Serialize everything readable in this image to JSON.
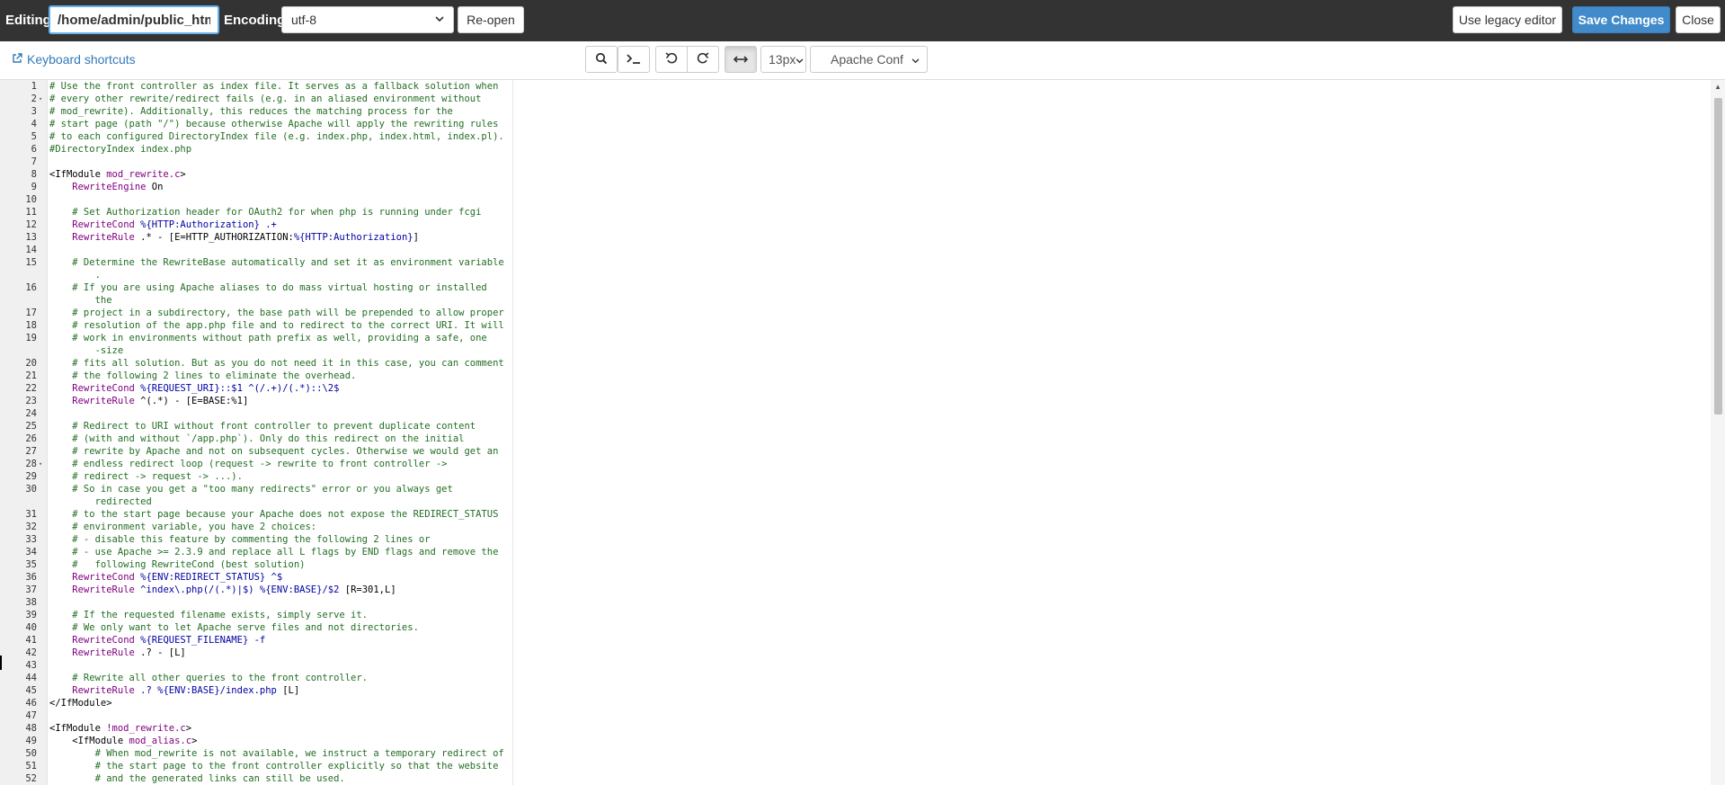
{
  "header": {
    "editing_label": "Editing:",
    "file_path": "/home/admin/public_htm",
    "encoding_label": "Encoding:",
    "encoding_value": "utf-8",
    "reopen_label": "Re-open",
    "legacy_label": "Use legacy editor",
    "save_label": "Save Changes",
    "close_label": "Close"
  },
  "toolbar": {
    "shortcuts_label": "Keyboard shortcuts",
    "font_size": "13px",
    "mode": "Apache Conf",
    "icons": [
      "search-icon",
      "terminal-icon",
      "undo-icon",
      "redo-icon",
      "wrap-icon"
    ]
  },
  "colors": {
    "topbar_bg": "#333333",
    "primary": "#428bca",
    "comment": "#236e24",
    "directive": "#800080",
    "variable": "#0000a2"
  },
  "editor": {
    "lines": [
      {
        "n": "1",
        "fold": "",
        "segs": [
          {
            "t": "# Use the front controller as index file. It serves as a fallback solution when",
            "c": "cmt"
          }
        ]
      },
      {
        "n": "2",
        "fold": "▾",
        "segs": [
          {
            "t": "# every other rewrite/redirect fails (e.g. in an aliased environment without",
            "c": "cmt"
          }
        ]
      },
      {
        "n": "3",
        "fold": "",
        "segs": [
          {
            "t": "# mod_rewrite). Additionally, this reduces the matching process for the",
            "c": "cmt"
          }
        ]
      },
      {
        "n": "4",
        "fold": "",
        "segs": [
          {
            "t": "# start page (path \"/\") because otherwise Apache will apply the rewriting rules",
            "c": "cmt"
          }
        ]
      },
      {
        "n": "5",
        "fold": "",
        "segs": [
          {
            "t": "# to each configured DirectoryIndex file (e.g. index.php, index.html, index.pl).",
            "c": "cmt"
          }
        ]
      },
      {
        "n": "6",
        "fold": "",
        "segs": [
          {
            "t": "#DirectoryIndex index.php",
            "c": "cmt"
          }
        ]
      },
      {
        "n": "7",
        "fold": "",
        "segs": []
      },
      {
        "n": "8",
        "fold": "",
        "segs": [
          {
            "t": "<IfModule ",
            "c": "tag"
          },
          {
            "t": "mod_rewrite.c",
            "c": "dir"
          },
          {
            "t": ">",
            "c": "tag"
          }
        ]
      },
      {
        "n": "9",
        "fold": "",
        "segs": [
          {
            "t": "    ",
            "c": ""
          },
          {
            "t": "RewriteEngine",
            "c": "dir"
          },
          {
            "t": " On",
            "c": ""
          }
        ]
      },
      {
        "n": "10",
        "fold": "",
        "segs": []
      },
      {
        "n": "11",
        "fold": "",
        "segs": [
          {
            "t": "    # Set Authorization header for OAuth2 for when php is running under fcgi",
            "c": "cmt"
          }
        ]
      },
      {
        "n": "12",
        "fold": "",
        "segs": [
          {
            "t": "    ",
            "c": ""
          },
          {
            "t": "RewriteCond",
            "c": "dir"
          },
          {
            "t": " %{HTTP:Authorization} .+",
            "c": "var"
          }
        ]
      },
      {
        "n": "13",
        "fold": "",
        "segs": [
          {
            "t": "    ",
            "c": ""
          },
          {
            "t": "RewriteRule",
            "c": "dir"
          },
          {
            "t": " .* - [E=HTTP_AUTHORIZATION:",
            "c": ""
          },
          {
            "t": "%{HTTP:Authorization}",
            "c": "var"
          },
          {
            "t": "]",
            "c": ""
          }
        ]
      },
      {
        "n": "14",
        "fold": "",
        "segs": []
      },
      {
        "n": "15",
        "fold": "",
        "segs": [
          {
            "t": "    # Determine the RewriteBase automatically and set it as environment variable",
            "c": "cmt"
          }
        ]
      },
      {
        "n": "",
        "fold": "",
        "segs": [
          {
            "t": "        .",
            "c": "cmt"
          }
        ]
      },
      {
        "n": "16",
        "fold": "",
        "segs": [
          {
            "t": "    # If you are using Apache aliases to do mass virtual hosting or installed",
            "c": "cmt"
          }
        ]
      },
      {
        "n": "",
        "fold": "",
        "segs": [
          {
            "t": "        the",
            "c": "cmt"
          }
        ]
      },
      {
        "n": "17",
        "fold": "",
        "segs": [
          {
            "t": "    # project in a subdirectory, the base path will be prepended to allow proper",
            "c": "cmt"
          }
        ]
      },
      {
        "n": "18",
        "fold": "",
        "segs": [
          {
            "t": "    # resolution of the app.php file and to redirect to the correct URI. It will",
            "c": "cmt"
          }
        ]
      },
      {
        "n": "19",
        "fold": "",
        "segs": [
          {
            "t": "    # work in environments without path prefix as well, providing a safe, one",
            "c": "cmt"
          }
        ]
      },
      {
        "n": "",
        "fold": "",
        "segs": [
          {
            "t": "        -size",
            "c": "cmt"
          }
        ]
      },
      {
        "n": "20",
        "fold": "",
        "segs": [
          {
            "t": "    # fits all solution. But as you do not need it in this case, you can comment",
            "c": "cmt"
          }
        ]
      },
      {
        "n": "21",
        "fold": "",
        "segs": [
          {
            "t": "    # the following 2 lines to eliminate the overhead.",
            "c": "cmt"
          }
        ]
      },
      {
        "n": "22",
        "fold": "",
        "segs": [
          {
            "t": "    ",
            "c": ""
          },
          {
            "t": "RewriteCond",
            "c": "dir"
          },
          {
            "t": " %{REQUEST_URI}::$1 ^(/.+)/(.*)::\\2$",
            "c": "var"
          }
        ]
      },
      {
        "n": "23",
        "fold": "",
        "segs": [
          {
            "t": "    ",
            "c": ""
          },
          {
            "t": "RewriteRule",
            "c": "dir"
          },
          {
            "t": " ^(.*) - [E=BASE:%1]",
            "c": ""
          }
        ]
      },
      {
        "n": "24",
        "fold": "",
        "segs": []
      },
      {
        "n": "25",
        "fold": "",
        "segs": [
          {
            "t": "    # Redirect to URI without front controller to prevent duplicate content",
            "c": "cmt"
          }
        ]
      },
      {
        "n": "26",
        "fold": "",
        "segs": [
          {
            "t": "    # (with and without `/app.php`). Only do this redirect on the initial",
            "c": "cmt"
          }
        ]
      },
      {
        "n": "27",
        "fold": "",
        "segs": [
          {
            "t": "    # rewrite by Apache and not on subsequent cycles. Otherwise we would get an",
            "c": "cmt"
          }
        ]
      },
      {
        "n": "28",
        "fold": "▾",
        "segs": [
          {
            "t": "    # endless redirect loop (request -> rewrite to front controller ->",
            "c": "cmt"
          }
        ]
      },
      {
        "n": "29",
        "fold": "",
        "segs": [
          {
            "t": "    # redirect -> request -> ...).",
            "c": "cmt"
          }
        ]
      },
      {
        "n": "30",
        "fold": "",
        "segs": [
          {
            "t": "    # So in case you get a \"too many redirects\" error or you always get",
            "c": "cmt"
          }
        ]
      },
      {
        "n": "",
        "fold": "",
        "segs": [
          {
            "t": "        redirected",
            "c": "cmt"
          }
        ]
      },
      {
        "n": "31",
        "fold": "",
        "segs": [
          {
            "t": "    # to the start page because your Apache does not expose the REDIRECT_STATUS",
            "c": "cmt"
          }
        ]
      },
      {
        "n": "32",
        "fold": "",
        "segs": [
          {
            "t": "    # environment variable, you have 2 choices:",
            "c": "cmt"
          }
        ]
      },
      {
        "n": "33",
        "fold": "",
        "segs": [
          {
            "t": "    # - disable this feature by commenting the following 2 lines or",
            "c": "cmt"
          }
        ]
      },
      {
        "n": "34",
        "fold": "",
        "segs": [
          {
            "t": "    # - use Apache >= 2.3.9 and replace all L flags by END flags and remove the",
            "c": "cmt"
          }
        ]
      },
      {
        "n": "35",
        "fold": "",
        "segs": [
          {
            "t": "    #   following RewriteCond (best solution)",
            "c": "cmt"
          }
        ]
      },
      {
        "n": "36",
        "fold": "",
        "segs": [
          {
            "t": "    ",
            "c": ""
          },
          {
            "t": "RewriteCond",
            "c": "dir"
          },
          {
            "t": " %{ENV:REDIRECT_STATUS} ^$",
            "c": "var"
          }
        ]
      },
      {
        "n": "37",
        "fold": "",
        "segs": [
          {
            "t": "    ",
            "c": ""
          },
          {
            "t": "RewriteRule",
            "c": "dir"
          },
          {
            "t": " ^index\\.php(/(.*)|$) %{ENV:BASE}/$2",
            "c": "var"
          },
          {
            "t": " [R=301,L]",
            "c": ""
          }
        ]
      },
      {
        "n": "38",
        "fold": "",
        "segs": []
      },
      {
        "n": "39",
        "fold": "",
        "segs": [
          {
            "t": "    # If the requested filename exists, simply serve it.",
            "c": "cmt"
          }
        ]
      },
      {
        "n": "40",
        "fold": "",
        "segs": [
          {
            "t": "    # We only want to let Apache serve files and not directories.",
            "c": "cmt"
          }
        ]
      },
      {
        "n": "41",
        "fold": "",
        "segs": [
          {
            "t": "    ",
            "c": ""
          },
          {
            "t": "RewriteCond",
            "c": "dir"
          },
          {
            "t": " %{REQUEST_FILENAME} -f",
            "c": "var"
          }
        ]
      },
      {
        "n": "42",
        "fold": "",
        "segs": [
          {
            "t": "    ",
            "c": ""
          },
          {
            "t": "RewriteRule",
            "c": "dir"
          },
          {
            "t": " .? - [L]",
            "c": ""
          }
        ]
      },
      {
        "n": "43",
        "fold": "",
        "segs": []
      },
      {
        "n": "44",
        "fold": "",
        "segs": [
          {
            "t": "    # Rewrite all other queries to the front controller.",
            "c": "cmt"
          }
        ]
      },
      {
        "n": "45",
        "fold": "",
        "segs": [
          {
            "t": "    ",
            "c": ""
          },
          {
            "t": "RewriteRule",
            "c": "dir"
          },
          {
            "t": " .? %{ENV:BASE}/index.php",
            "c": "var"
          },
          {
            "t": " [L]",
            "c": ""
          }
        ]
      },
      {
        "n": "46",
        "fold": "",
        "segs": [
          {
            "t": "</IfModule>",
            "c": "tag"
          }
        ]
      },
      {
        "n": "47",
        "fold": "",
        "segs": []
      },
      {
        "n": "48",
        "fold": "",
        "segs": [
          {
            "t": "<IfModule ",
            "c": "tag"
          },
          {
            "t": "!mod_rewrite.c",
            "c": "dir"
          },
          {
            "t": ">",
            "c": "tag"
          }
        ]
      },
      {
        "n": "49",
        "fold": "",
        "segs": [
          {
            "t": "    <IfModule ",
            "c": "tag"
          },
          {
            "t": "mod_alias.c",
            "c": "dir"
          },
          {
            "t": ">",
            "c": "tag"
          }
        ]
      },
      {
        "n": "50",
        "fold": "",
        "segs": [
          {
            "t": "        # When mod_rewrite is not available, we instruct a temporary redirect of",
            "c": "cmt"
          }
        ]
      },
      {
        "n": "51",
        "fold": "",
        "segs": [
          {
            "t": "        # the start page to the front controller explicitly so that the website",
            "c": "cmt"
          }
        ]
      },
      {
        "n": "52",
        "fold": "",
        "segs": [
          {
            "t": "        # and the generated links can still be used.",
            "c": "cmt"
          }
        ]
      }
    ]
  }
}
